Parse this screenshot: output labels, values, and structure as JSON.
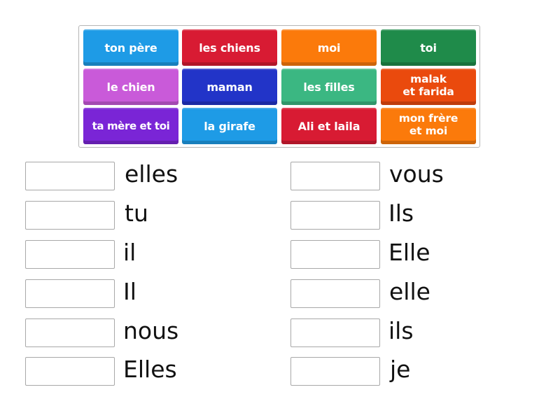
{
  "tiles": [
    {
      "label": "ton père",
      "color": "#1e9be6"
    },
    {
      "label": "les chiens",
      "color": "#d81b33"
    },
    {
      "label": "moi",
      "color": "#fb7a0b"
    },
    {
      "label": "toi",
      "color": "#1f8b4a"
    },
    {
      "label": "le chien",
      "color": "#c95ad9"
    },
    {
      "label": "maman",
      "color": "#2234c8"
    },
    {
      "label": "les filles",
      "color": "#3bb782"
    },
    {
      "label": "malak\net farida",
      "color": "#ea4a0d"
    },
    {
      "label": "ta mère et toi",
      "color": "#7a25d6"
    },
    {
      "label": "la girafe",
      "color": "#1e9be6"
    },
    {
      "label": "Ali et laila",
      "color": "#d81b33"
    },
    {
      "label": "mon frère\net moi",
      "color": "#fb7a0b"
    }
  ],
  "left_targets": [
    {
      "label": "elles",
      "value": ""
    },
    {
      "label": "tu",
      "value": ""
    },
    {
      "label": "il",
      "value": ""
    },
    {
      "label": "Il",
      "value": ""
    },
    {
      "label": "nous",
      "value": ""
    },
    {
      "label": "Elles",
      "value": ""
    }
  ],
  "right_targets": [
    {
      "label": "vous",
      "value": ""
    },
    {
      "label": "Ils",
      "value": ""
    },
    {
      "label": "Elle",
      "value": ""
    },
    {
      "label": "elle",
      "value": ""
    },
    {
      "label": "ils",
      "value": ""
    },
    {
      "label": "je",
      "value": ""
    }
  ]
}
